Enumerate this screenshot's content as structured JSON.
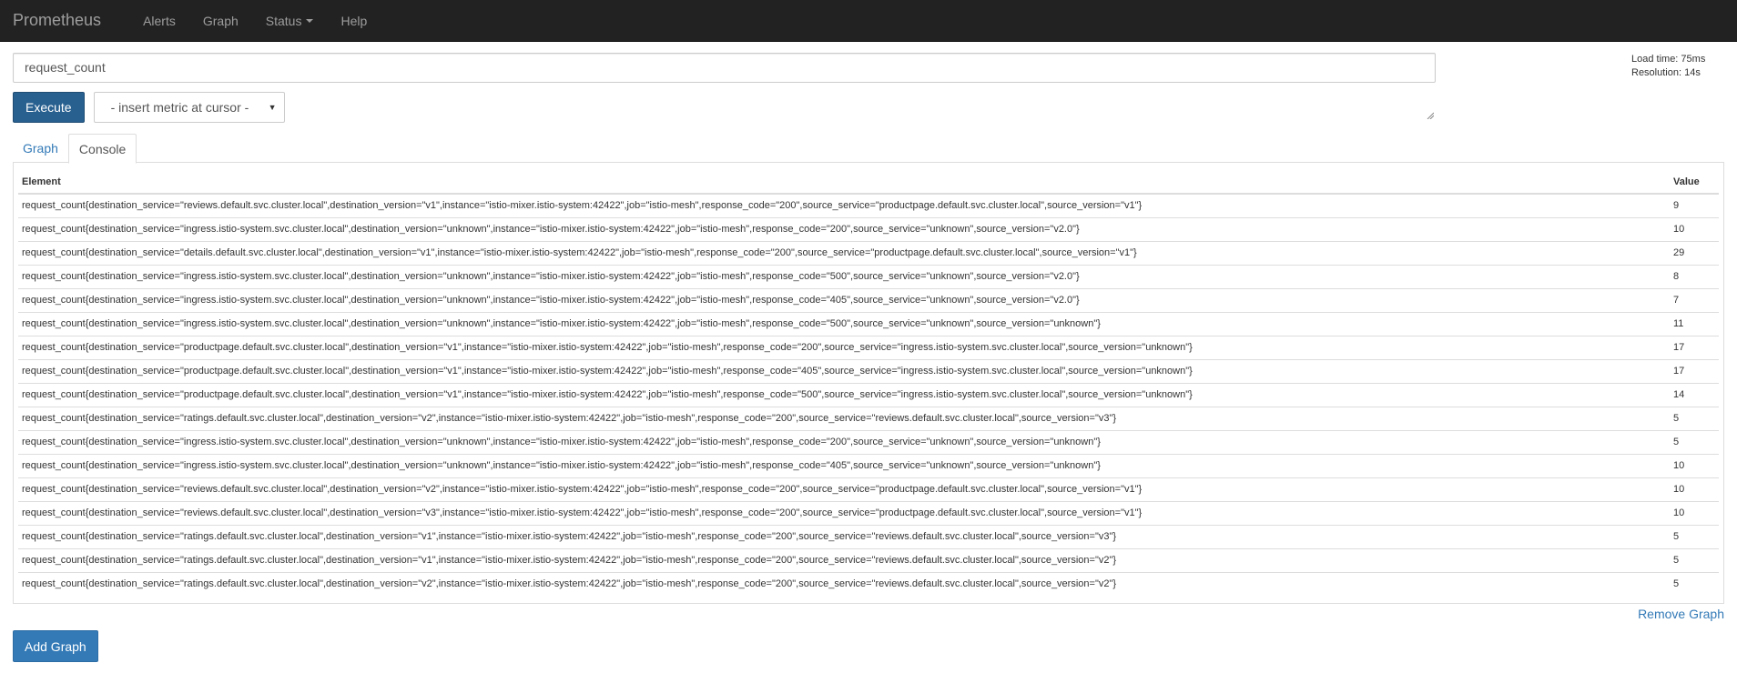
{
  "nav": {
    "brand": "Prometheus",
    "items": [
      {
        "label": "Alerts"
      },
      {
        "label": "Graph"
      },
      {
        "label": "Status"
      },
      {
        "label": "Help"
      }
    ]
  },
  "query": {
    "expression": "request_count",
    "execute_label": "Execute",
    "metric_select": "- insert metric at cursor -"
  },
  "stats": {
    "load_time": "Load time: 75ms",
    "resolution": "Resolution: 14s"
  },
  "tabs": [
    {
      "label": "Graph",
      "active": false
    },
    {
      "label": "Console",
      "active": true
    }
  ],
  "table": {
    "headers": {
      "element": "Element",
      "value": "Value"
    },
    "rows": [
      {
        "element": "request_count{destination_service=\"reviews.default.svc.cluster.local\",destination_version=\"v1\",instance=\"istio-mixer.istio-system:42422\",job=\"istio-mesh\",response_code=\"200\",source_service=\"productpage.default.svc.cluster.local\",source_version=\"v1\"}",
        "value": "9"
      },
      {
        "element": "request_count{destination_service=\"ingress.istio-system.svc.cluster.local\",destination_version=\"unknown\",instance=\"istio-mixer.istio-system:42422\",job=\"istio-mesh\",response_code=\"200\",source_service=\"unknown\",source_version=\"v2.0\"}",
        "value": "10"
      },
      {
        "element": "request_count{destination_service=\"details.default.svc.cluster.local\",destination_version=\"v1\",instance=\"istio-mixer.istio-system:42422\",job=\"istio-mesh\",response_code=\"200\",source_service=\"productpage.default.svc.cluster.local\",source_version=\"v1\"}",
        "value": "29"
      },
      {
        "element": "request_count{destination_service=\"ingress.istio-system.svc.cluster.local\",destination_version=\"unknown\",instance=\"istio-mixer.istio-system:42422\",job=\"istio-mesh\",response_code=\"500\",source_service=\"unknown\",source_version=\"v2.0\"}",
        "value": "8"
      },
      {
        "element": "request_count{destination_service=\"ingress.istio-system.svc.cluster.local\",destination_version=\"unknown\",instance=\"istio-mixer.istio-system:42422\",job=\"istio-mesh\",response_code=\"405\",source_service=\"unknown\",source_version=\"v2.0\"}",
        "value": "7"
      },
      {
        "element": "request_count{destination_service=\"ingress.istio-system.svc.cluster.local\",destination_version=\"unknown\",instance=\"istio-mixer.istio-system:42422\",job=\"istio-mesh\",response_code=\"500\",source_service=\"unknown\",source_version=\"unknown\"}",
        "value": "11"
      },
      {
        "element": "request_count{destination_service=\"productpage.default.svc.cluster.local\",destination_version=\"v1\",instance=\"istio-mixer.istio-system:42422\",job=\"istio-mesh\",response_code=\"200\",source_service=\"ingress.istio-system.svc.cluster.local\",source_version=\"unknown\"}",
        "value": "17"
      },
      {
        "element": "request_count{destination_service=\"productpage.default.svc.cluster.local\",destination_version=\"v1\",instance=\"istio-mixer.istio-system:42422\",job=\"istio-mesh\",response_code=\"405\",source_service=\"ingress.istio-system.svc.cluster.local\",source_version=\"unknown\"}",
        "value": "17"
      },
      {
        "element": "request_count{destination_service=\"productpage.default.svc.cluster.local\",destination_version=\"v1\",instance=\"istio-mixer.istio-system:42422\",job=\"istio-mesh\",response_code=\"500\",source_service=\"ingress.istio-system.svc.cluster.local\",source_version=\"unknown\"}",
        "value": "14"
      },
      {
        "element": "request_count{destination_service=\"ratings.default.svc.cluster.local\",destination_version=\"v2\",instance=\"istio-mixer.istio-system:42422\",job=\"istio-mesh\",response_code=\"200\",source_service=\"reviews.default.svc.cluster.local\",source_version=\"v3\"}",
        "value": "5"
      },
      {
        "element": "request_count{destination_service=\"ingress.istio-system.svc.cluster.local\",destination_version=\"unknown\",instance=\"istio-mixer.istio-system:42422\",job=\"istio-mesh\",response_code=\"200\",source_service=\"unknown\",source_version=\"unknown\"}",
        "value": "5"
      },
      {
        "element": "request_count{destination_service=\"ingress.istio-system.svc.cluster.local\",destination_version=\"unknown\",instance=\"istio-mixer.istio-system:42422\",job=\"istio-mesh\",response_code=\"405\",source_service=\"unknown\",source_version=\"unknown\"}",
        "value": "10"
      },
      {
        "element": "request_count{destination_service=\"reviews.default.svc.cluster.local\",destination_version=\"v2\",instance=\"istio-mixer.istio-system:42422\",job=\"istio-mesh\",response_code=\"200\",source_service=\"productpage.default.svc.cluster.local\",source_version=\"v1\"}",
        "value": "10"
      },
      {
        "element": "request_count{destination_service=\"reviews.default.svc.cluster.local\",destination_version=\"v3\",instance=\"istio-mixer.istio-system:42422\",job=\"istio-mesh\",response_code=\"200\",source_service=\"productpage.default.svc.cluster.local\",source_version=\"v1\"}",
        "value": "10"
      },
      {
        "element": "request_count{destination_service=\"ratings.default.svc.cluster.local\",destination_version=\"v1\",instance=\"istio-mixer.istio-system:42422\",job=\"istio-mesh\",response_code=\"200\",source_service=\"reviews.default.svc.cluster.local\",source_version=\"v3\"}",
        "value": "5"
      },
      {
        "element": "request_count{destination_service=\"ratings.default.svc.cluster.local\",destination_version=\"v1\",instance=\"istio-mixer.istio-system:42422\",job=\"istio-mesh\",response_code=\"200\",source_service=\"reviews.default.svc.cluster.local\",source_version=\"v2\"}",
        "value": "5"
      },
      {
        "element": "request_count{destination_service=\"ratings.default.svc.cluster.local\",destination_version=\"v2\",instance=\"istio-mixer.istio-system:42422\",job=\"istio-mesh\",response_code=\"200\",source_service=\"reviews.default.svc.cluster.local\",source_version=\"v2\"}",
        "value": "5"
      }
    ]
  },
  "actions": {
    "remove_graph": "Remove Graph",
    "add_graph": "Add Graph"
  },
  "icons": {
    "status_caret": "caret-down-icon",
    "select_arrow": "chevron-down-icon",
    "resize_grip": "resize-grip-icon"
  },
  "colors": {
    "navbar": "#222222",
    "nav_text": "#9d9d9d",
    "primary": "#286090",
    "link": "#337ab7"
  }
}
